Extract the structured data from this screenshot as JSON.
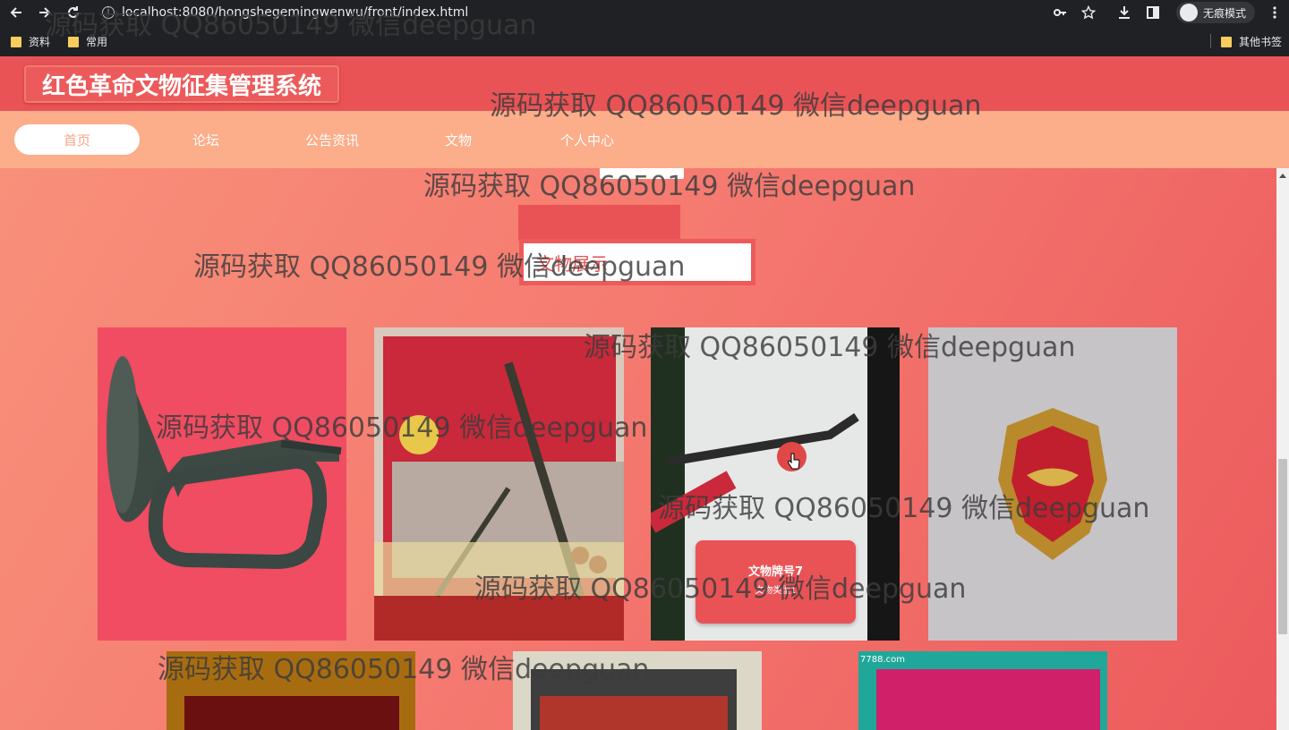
{
  "browser": {
    "url": "localhost:8080/hongshegemingwenwu/front/index.html",
    "incognito_label": "无痕模式",
    "bookmarks": [
      {
        "label": "资料"
      },
      {
        "label": "常用"
      }
    ],
    "other_bookmarks": "其他书签"
  },
  "site": {
    "title": "红色革命文物征集管理系统",
    "menu": [
      {
        "label": "首页",
        "active": true
      },
      {
        "label": "论坛",
        "active": false
      },
      {
        "label": "公告资讯",
        "active": false
      },
      {
        "label": "文物",
        "active": false
      },
      {
        "label": "个人中心",
        "active": false
      }
    ]
  },
  "section": {
    "title": "文物展示"
  },
  "artifacts": [
    {
      "image": "bugle-photo"
    },
    {
      "image": "museum-display-photo"
    },
    {
      "image": "rifle-photo",
      "caption_name": "文物牌号7",
      "caption_type": "文物类型1"
    },
    {
      "image": "badge-photo"
    },
    {
      "image": "box-photo"
    },
    {
      "image": "red-fabric-photo"
    },
    {
      "image": "book-cover-photo",
      "overlay_text": "7788.com"
    }
  ],
  "watermark": "源码获取 QQ86050149 微信deepguan",
  "colors": {
    "header_red": "#ea5356",
    "menu_peach": "#fcad89",
    "accent_white": "#ffffff"
  }
}
